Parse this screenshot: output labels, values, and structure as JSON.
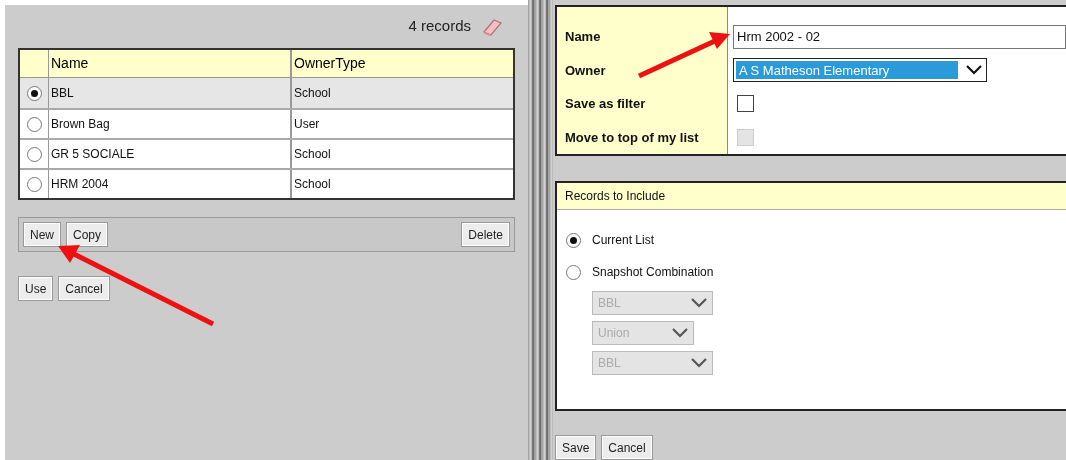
{
  "list_pane": {
    "record_count": "4 records",
    "table": {
      "columns": [
        "Name",
        "OwnerType"
      ],
      "rows": [
        {
          "name": "BBL",
          "owner_type": "School",
          "selected": true
        },
        {
          "name": "Brown Bag",
          "owner_type": "User",
          "selected": false
        },
        {
          "name": "GR 5 SOCIALE",
          "owner_type": "School",
          "selected": false
        },
        {
          "name": "HRM 2004",
          "owner_type": "School",
          "selected": false
        }
      ]
    },
    "toolbar_left": [
      "New",
      "Copy"
    ],
    "toolbar_right": [
      "Delete"
    ],
    "buttons": [
      "Use",
      "Cancel"
    ]
  },
  "detail_pane": {
    "fields": [
      {
        "kind": "text",
        "label": "Name",
        "value": "Hrm 2002 - 02"
      },
      {
        "kind": "select",
        "label": "Owner",
        "value": "A S Matheson Elementary"
      },
      {
        "kind": "checkbox",
        "label": "Save as filter",
        "checked": false,
        "disabled": false
      },
      {
        "kind": "checkbox",
        "label": "Move to top of my list",
        "checked": false,
        "disabled": true
      }
    ],
    "records_section": {
      "title": "Records to Include",
      "options": [
        {
          "label": "Current List",
          "selected": true
        },
        {
          "label": "Snapshot Combination",
          "selected": false
        }
      ],
      "combination": [
        {
          "value": "BBL",
          "disabled": true,
          "wide": true
        },
        {
          "value": "Union",
          "disabled": true,
          "wide": false
        },
        {
          "value": "BBL",
          "disabled": true,
          "wide": true
        }
      ]
    },
    "buttons": [
      "Save",
      "Cancel"
    ]
  }
}
